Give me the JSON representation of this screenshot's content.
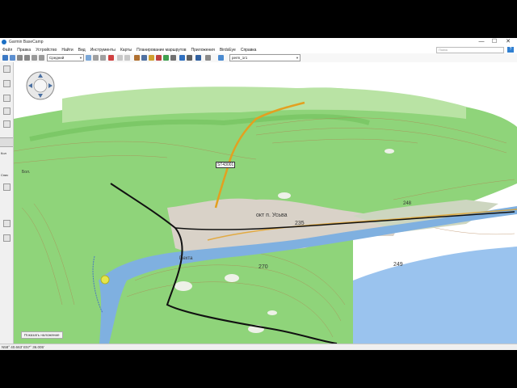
{
  "window": {
    "title": "Garmin BaseCamp",
    "controls": [
      "—",
      "☐",
      "✕"
    ]
  },
  "menu": {
    "items": [
      "Файл",
      "Правка",
      "Устройство",
      "Найти",
      "Вид",
      "Инструменты",
      "Карты",
      "Планирование маршрутов",
      "Приложения",
      "BirdsEye",
      "Справка"
    ],
    "search_placeholder": "Поиск"
  },
  "toolbar": {
    "detail_select": "Средний",
    "profile_select": "perm_1r1"
  },
  "map": {
    "route_label": "ST43001",
    "place_label": "окт п. Усьва",
    "village_label": "Пехта",
    "left_label": "Бол.",
    "elevations": [
      "235",
      "248",
      "270",
      "249"
    ],
    "overlay_button": "Показать наложение"
  },
  "sidebar": {
    "labels": [
      "Кол",
      "Спис"
    ]
  },
  "status": {
    "coords": "N58° 40.663' E57° 36.005'"
  },
  "colors": {
    "terrain": "#8fd47a",
    "terrain_light": "#c9e9b9",
    "urban": "#d9d2c8",
    "river": "#7fb0e0",
    "lake": "#9ac3ee",
    "contour": "#b08050",
    "road_major": "#e3a020",
    "railway": "#111111"
  }
}
